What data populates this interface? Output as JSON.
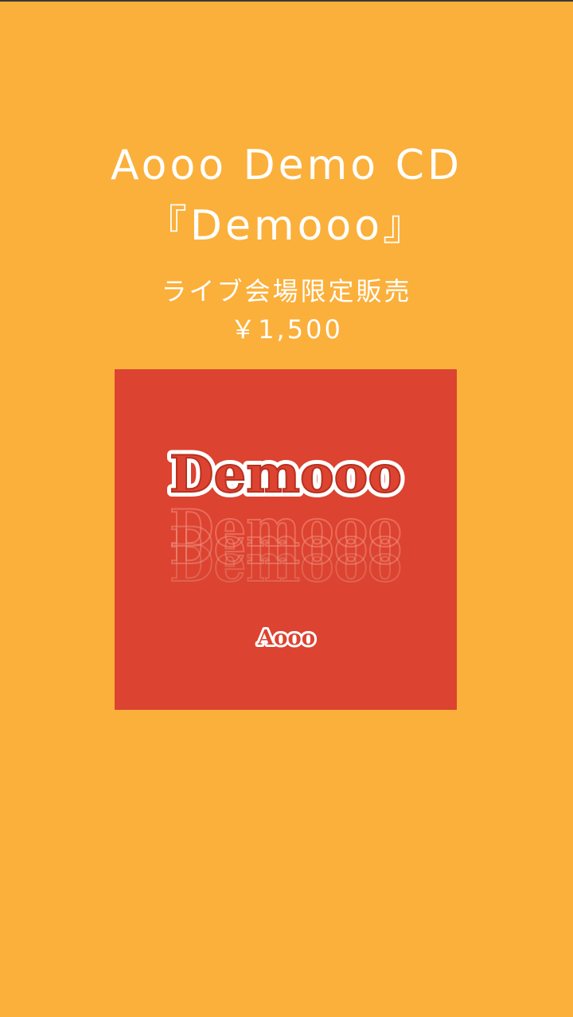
{
  "header": {
    "title_line1": "Aooo Demo CD",
    "title_line2": "『Demooo』",
    "note": "ライブ会場限定販売",
    "price": "￥1,500"
  },
  "cover": {
    "main_logo_text": "Demooo",
    "band_logo_text": "Aooo"
  },
  "colors": {
    "background": "#FBB03B",
    "cover": "#DC4330",
    "text": "#ffffff"
  }
}
